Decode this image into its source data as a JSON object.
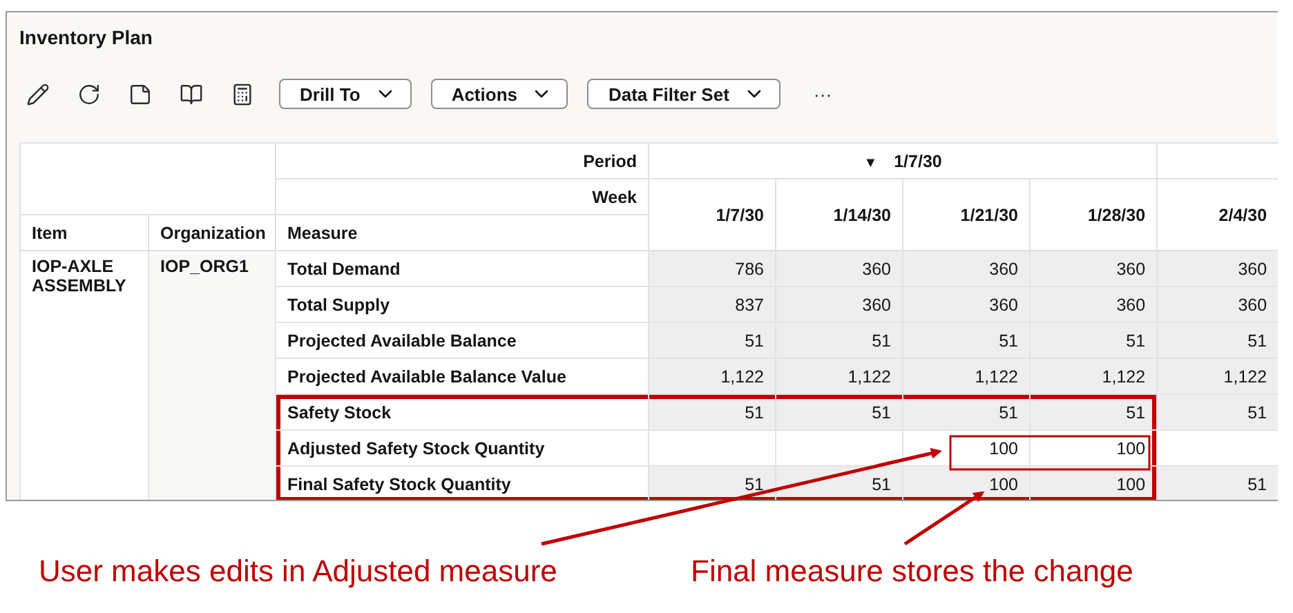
{
  "title": "Inventory Plan",
  "toolbar": {
    "buttons": [
      "Drill To",
      "Actions",
      "Data Filter Set"
    ],
    "more": "···"
  },
  "table": {
    "header": {
      "period_label": "Period",
      "week_label": "Week",
      "period": "1/7/30",
      "period_caret": "▼",
      "columns": [
        "Item",
        "Organization",
        "Measure"
      ],
      "weeks": [
        "1/7/30",
        "1/14/30",
        "1/21/30",
        "1/28/30",
        "2/4/30"
      ]
    },
    "item": "IOP-AXLE ASSEMBLY",
    "organization": "IOP_ORG1",
    "rows": [
      {
        "measure": "Total Demand",
        "cells": [
          {
            "value": "786",
            "editable": false
          },
          {
            "value": "360",
            "editable": false
          },
          {
            "value": "360",
            "editable": false
          },
          {
            "value": "360",
            "editable": false
          },
          {
            "value": "360",
            "editable": false
          }
        ]
      },
      {
        "measure": "Total Supply",
        "cells": [
          {
            "value": "837",
            "editable": false
          },
          {
            "value": "360",
            "editable": false
          },
          {
            "value": "360",
            "editable": false
          },
          {
            "value": "360",
            "editable": false
          },
          {
            "value": "360",
            "editable": false
          }
        ]
      },
      {
        "measure": "Projected Available Balance",
        "cells": [
          {
            "value": "51",
            "editable": false
          },
          {
            "value": "51",
            "editable": false
          },
          {
            "value": "51",
            "editable": false
          },
          {
            "value": "51",
            "editable": false
          },
          {
            "value": "51",
            "editable": false
          }
        ]
      },
      {
        "measure": "Projected Available Balance Value",
        "cells": [
          {
            "value": "1,122",
            "editable": false
          },
          {
            "value": "1,122",
            "editable": false
          },
          {
            "value": "1,122",
            "editable": false
          },
          {
            "value": "1,122",
            "editable": false
          },
          {
            "value": "1,122",
            "editable": false
          }
        ]
      }
    ],
    "highlighted_rows": [
      {
        "measure": "Safety Stock",
        "cells": [
          {
            "value": "51",
            "editable": false
          },
          {
            "value": "51",
            "editable": false
          },
          {
            "value": "51",
            "editable": false
          },
          {
            "value": "51",
            "editable": false
          },
          {
            "value": "51",
            "editable": false
          }
        ]
      },
      {
        "measure": "Adjusted Safety Stock Quantity",
        "cells": [
          {
            "editable": true
          },
          {
            "editable": true
          },
          {
            "value": "100",
            "editable": true
          },
          {
            "value": "100",
            "editable": true
          },
          {
            "editable": true
          }
        ]
      },
      {
        "measure": "Final Safety Stock Quantity",
        "cells": [
          {
            "value": "51",
            "editable": false
          },
          {
            "value": "51",
            "editable": false
          },
          {
            "value": "100",
            "editable": false
          },
          {
            "value": "100",
            "editable": false
          },
          {
            "value": "51",
            "editable": false
          }
        ]
      }
    ]
  },
  "captions": [
    "User makes edits in Adjusted measure",
    "Final measure stores the change"
  ]
}
